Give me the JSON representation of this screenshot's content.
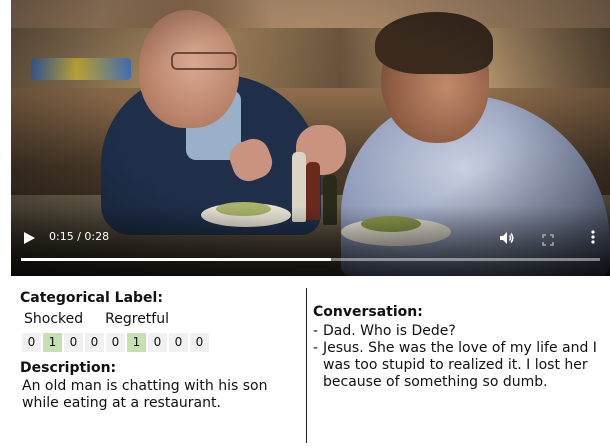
{
  "player": {
    "time": "0:15 / 0:28",
    "progress_fraction": 0.536,
    "icons": {
      "play": "play-icon",
      "volume": "volume-icon",
      "fullscreen": "fullscreen-icon",
      "more": "more-vert-icon"
    }
  },
  "labels": {
    "heading": "Categorical Label:",
    "names": [
      "Shocked",
      "Regretful"
    ],
    "values": [
      "0",
      "1",
      "0",
      "0",
      "0",
      "1",
      "0",
      "0",
      "0"
    ],
    "highlight_color": "#c6e0b3"
  },
  "description": {
    "heading": "Description:",
    "text": "An old man is chatting with his son while eating at a restaurant."
  },
  "conversation": {
    "heading": "Conversation:",
    "lines": [
      "Dad. Who is Dede?",
      "Jesus. She was the love of my life and I was too stupid to realized it. I lost her because of something so dumb."
    ]
  }
}
